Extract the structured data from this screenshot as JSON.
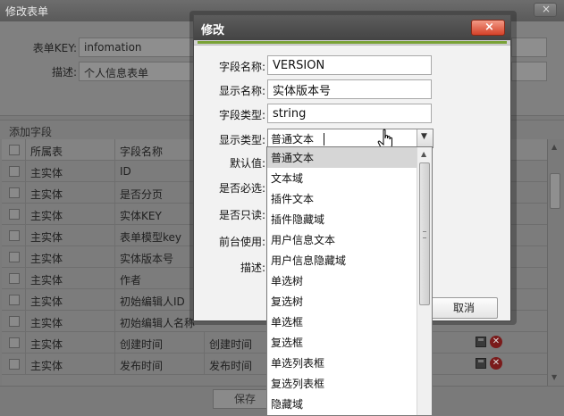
{
  "bg": {
    "title": "修改表单",
    "close": "×",
    "form": {
      "key_label": "表单KEY:",
      "key_value": "infomation",
      "desc_label": "描述:",
      "desc_value": "个人信息表单"
    },
    "grid_title": "添加字段",
    "table": {
      "headers": [
        "所属表",
        "字段名称"
      ],
      "rows": [
        {
          "table": "主实体",
          "field": "ID",
          "display": ""
        },
        {
          "table": "主实体",
          "field": "是否分页",
          "display": ""
        },
        {
          "table": "主实体",
          "field": "实体KEY",
          "display": ""
        },
        {
          "table": "主实体",
          "field": "表单模型key",
          "display": ""
        },
        {
          "table": "主实体",
          "field": "实体版本号",
          "display": ""
        },
        {
          "table": "主实体",
          "field": "作者",
          "display": ""
        },
        {
          "table": "主实体",
          "field": "初始编辑人ID",
          "display": ""
        },
        {
          "table": "主实体",
          "field": "初始编辑人名称",
          "display": ""
        },
        {
          "table": "主实体",
          "field": "创建时间",
          "display": "创建时间"
        },
        {
          "table": "主实体",
          "field": "发布时间",
          "display": "发布时间"
        }
      ]
    },
    "save_label": "保存"
  },
  "dialog": {
    "title": "修改",
    "close": "×",
    "fields": {
      "field_name_label": "字段名称:",
      "field_name_value": "VERSION",
      "display_name_label": "显示名称:",
      "display_name_value": "实体版本号",
      "field_type_label": "字段类型:",
      "field_type_value": "string",
      "display_type_label": "显示类型:",
      "display_type_value": "普通文本",
      "default_label": "默认值:",
      "required_label": "是否必选:",
      "readonly_label": "是否只读:",
      "frontend_label": "前台使用:",
      "desc_label": "描述:"
    },
    "cancel_label": "取消"
  },
  "dropdown": {
    "options": [
      "普通文本",
      "文本域",
      "插件文本",
      "插件隐藏域",
      "用户信息文本",
      "用户信息隐藏域",
      "单选树",
      "复选树",
      "单选框",
      "复选框",
      "单选列表框",
      "复选列表框",
      "隐藏域"
    ],
    "selected": "普通文本"
  },
  "icons": {
    "save": "save-icon",
    "delete": "delete-icon",
    "cursor": "hand-pointer-icon"
  },
  "colors": {
    "accent_green": "#79a236",
    "close_red": "#d54229"
  }
}
